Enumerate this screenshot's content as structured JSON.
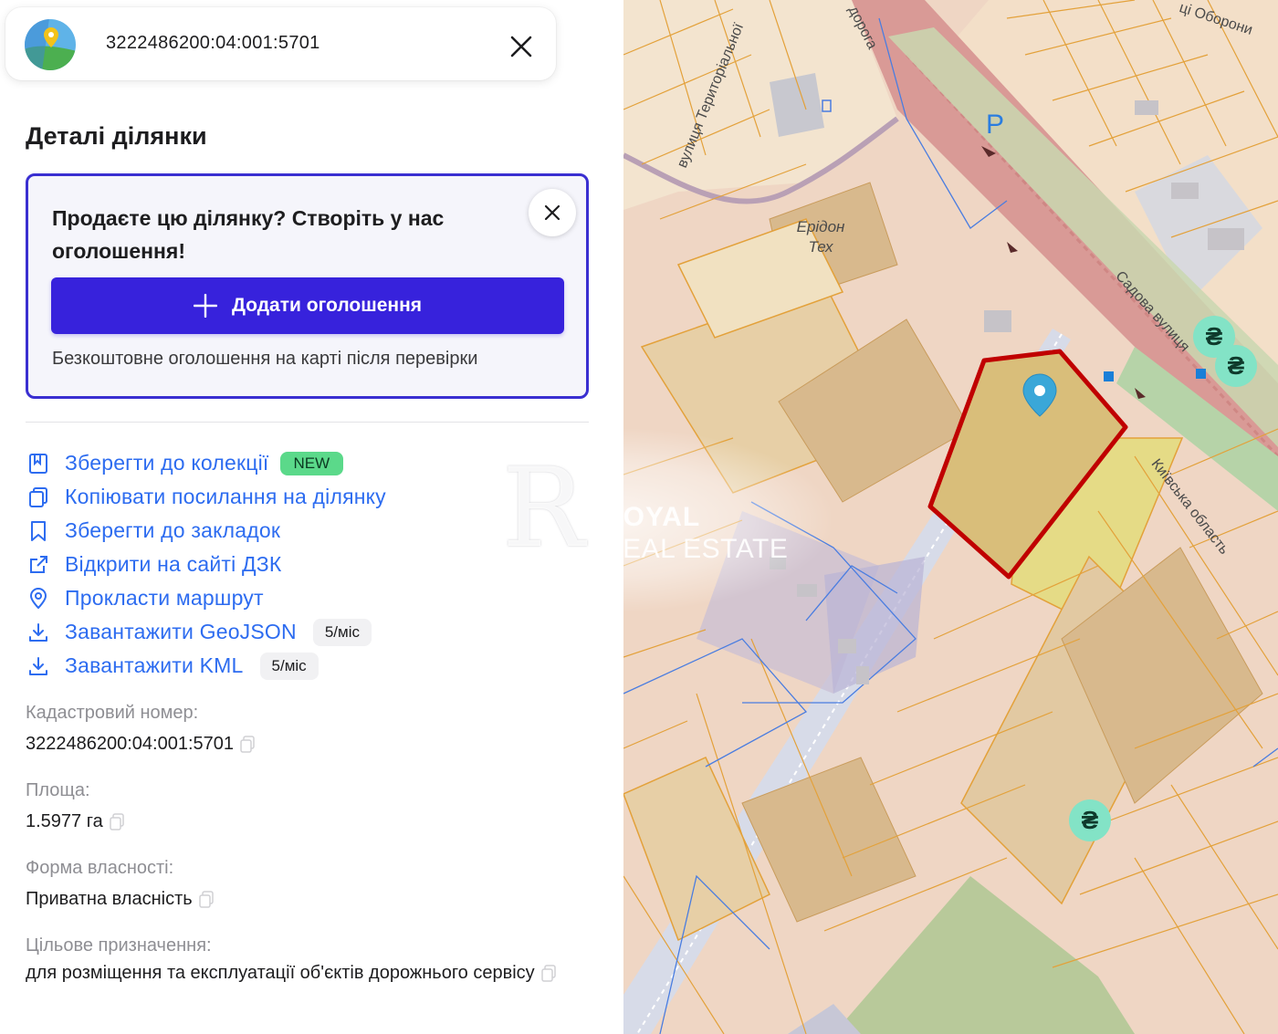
{
  "search": {
    "query": "3222486200:04:001:5701"
  },
  "details": {
    "title": "Деталі ділянки",
    "promo": {
      "text": "Продаєте цю ділянку? Створіть у нас оголошення!",
      "button_label": "Додати оголошення",
      "note": "Безкоштовне оголошення на карті після перевірки"
    },
    "actions": [
      {
        "label": "Зберегти до колекції",
        "icon": "collection-icon",
        "badge": "NEW"
      },
      {
        "label": "Копіювати посилання на ділянку",
        "icon": "copy-link-icon"
      },
      {
        "label": "Зберегти до закладок",
        "icon": "bookmark-icon"
      },
      {
        "label": "Відкрити на сайті ДЗК",
        "icon": "external-link-icon"
      },
      {
        "label": "Прокласти маршрут",
        "icon": "location-pin-icon"
      },
      {
        "label": "Завантажити GeoJSON",
        "icon": "download-icon",
        "quota": "5/міс"
      },
      {
        "label": "Завантажити KML",
        "icon": "download-icon",
        "quota": "5/міс"
      }
    ],
    "fields": [
      {
        "label": "Кадастровий номер:",
        "value": "3222486200:04:001:5701"
      },
      {
        "label": "Площа:",
        "value": "1.5977 га"
      },
      {
        "label": "Форма власності:",
        "value": "Приватна власність"
      },
      {
        "label": "Цільове призначення:",
        "value": "для розміщення та експлуатації об'єктів дорожнього сервісу"
      }
    ]
  },
  "map": {
    "labels": {
      "road_top": "дорога",
      "street_oborony": "ці Оборони",
      "street_territorialnoi": "вулиця Територіальної",
      "company": "Ерідон Тех",
      "parking": "P",
      "street_sadova": "Садова вулиця",
      "kyiv_oblast": "Київська область"
    },
    "currency_symbol": "₴",
    "colors": {
      "selected_parcel": "#c00000",
      "parcel_lines": "#e3a13a",
      "marker": "#3aa7d8",
      "road": "#d98a8a"
    }
  },
  "watermark": {
    "letter": "R",
    "title": "ROYAL",
    "subtitle": "REAL ESTATE"
  }
}
